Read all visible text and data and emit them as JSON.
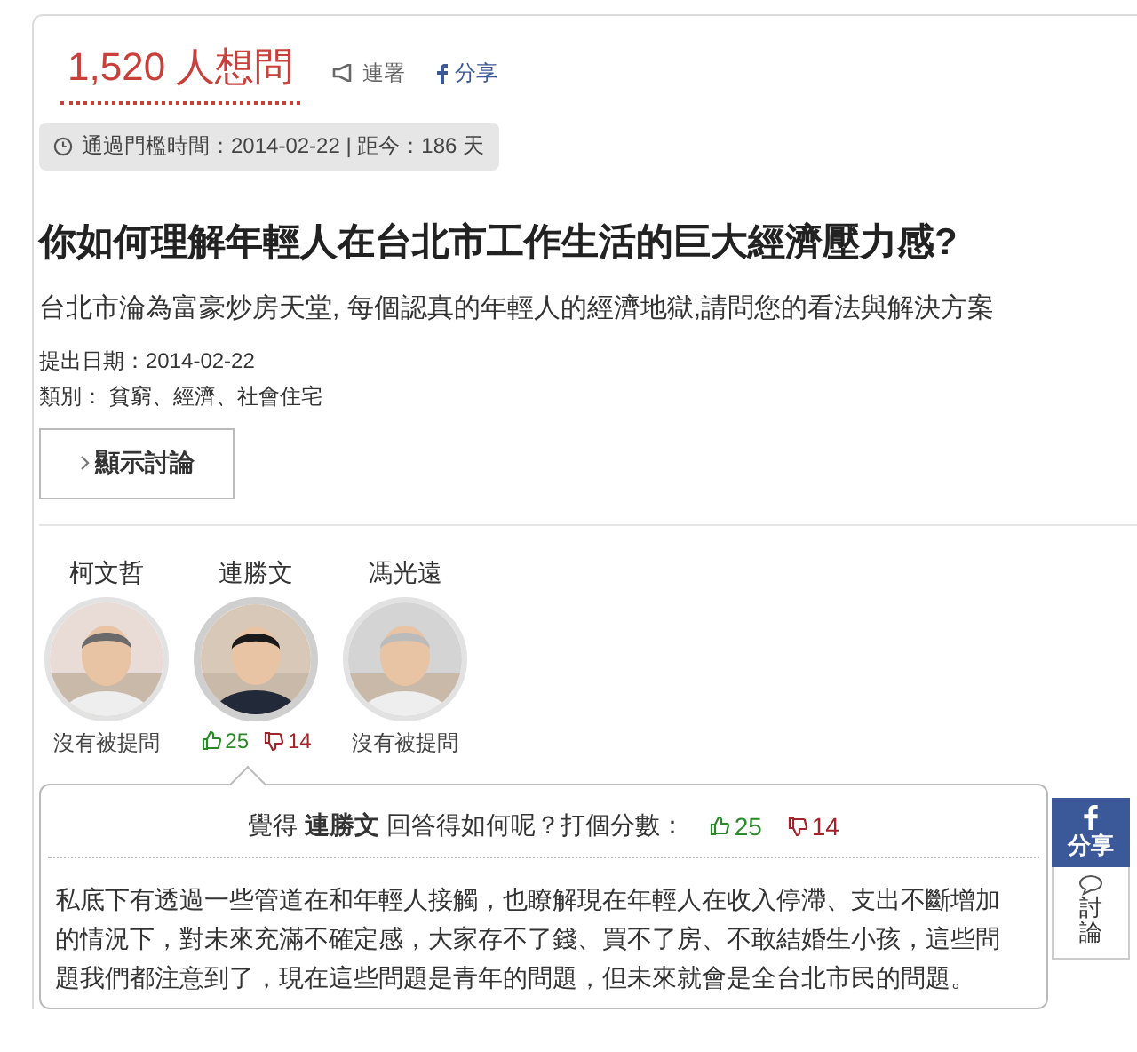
{
  "header": {
    "count": "1,520 人想問",
    "actions": [
      {
        "kind": "endorse",
        "label": "連署"
      },
      {
        "kind": "facebook",
        "label": "分享"
      }
    ]
  },
  "threshold": "通過門檻時間：2014-02-22 | 距今：186 天",
  "question": {
    "title": "你如何理解年輕人在台北市工作生活的巨大經濟壓力感?",
    "description": "台北市淪為富豪炒房天堂, 每個認真的年輕人的經濟地獄,請問您的看法與解決方案",
    "date": "提出日期：2014-02-22",
    "category": "類別： 貧窮、經濟、社會住宅"
  },
  "discussion_button": "顯示討論",
  "candidates": [
    {
      "name": "柯文哲",
      "selected": false,
      "kind": "none",
      "status": "沒有被提問"
    },
    {
      "name": "連勝文",
      "selected": true,
      "kind": "votes",
      "up": "25",
      "down": "14"
    },
    {
      "name": "馮光遠",
      "selected": false,
      "kind": "none",
      "status": "沒有被提問"
    }
  ],
  "answer": {
    "prompt_before": "覺得",
    "candidate": "連勝文",
    "prompt_after": "回答得如何呢？打個分數：",
    "up": "25",
    "down": "14",
    "text": "私底下有透過一些管道在和年輕人接觸，也瞭解現在年輕人在收入停滯、支出不斷增加的情況下，對未來充滿不確定感，大家存不了錢、買不了房、不敢結婚生小孩，這些問題我們都注意到了，現在這些問題是青年的問題，但未來就會是全台北市民的問題。"
  },
  "side_widget": {
    "share": "分享",
    "discuss": "討論"
  }
}
